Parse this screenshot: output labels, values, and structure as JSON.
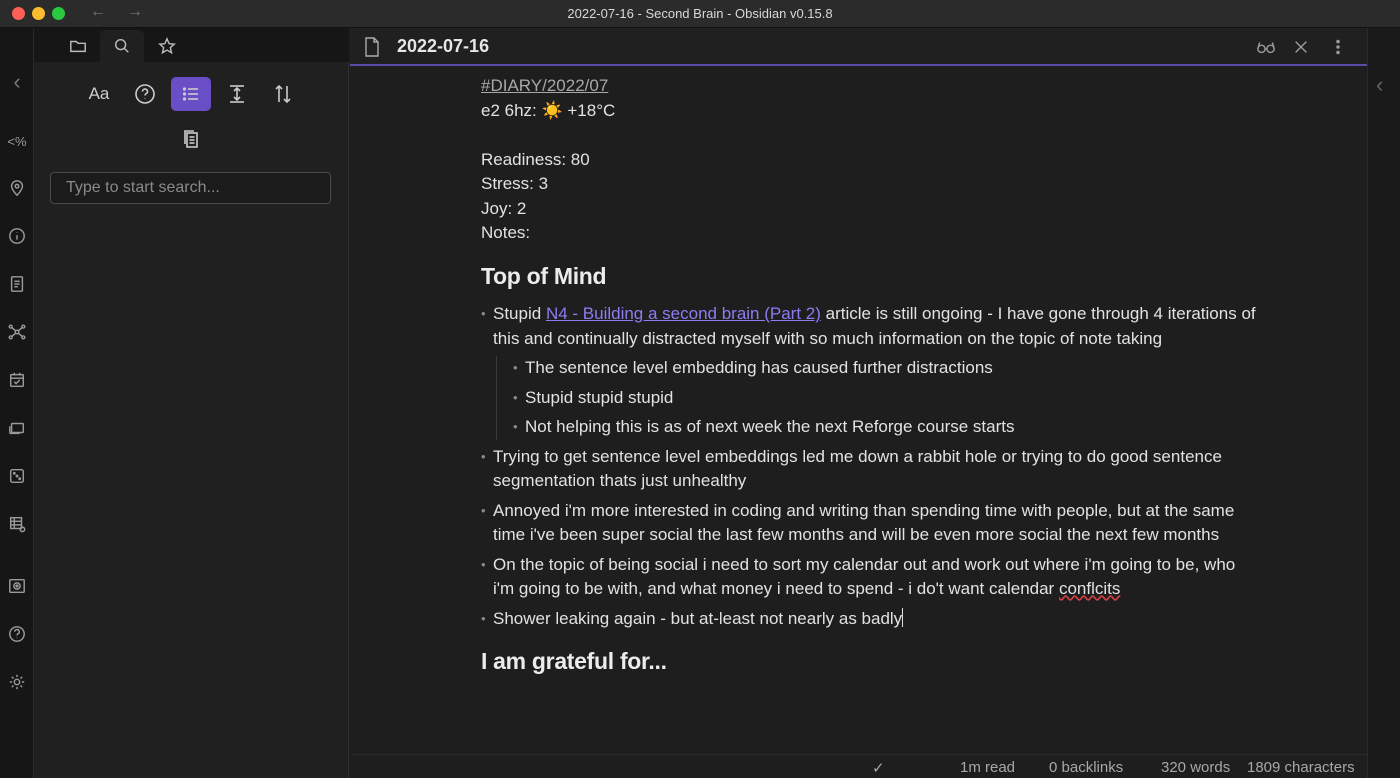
{
  "window": {
    "title": "2022-07-16 - Second Brain - Obsidian v0.15.8",
    "back_arrow": "←",
    "forward_arrow": "→"
  },
  "ribbon": {
    "collapse": "‹",
    "templater": "<%"
  },
  "side_panel": {
    "tabs": [
      "files-icon",
      "search-icon",
      "star-icon"
    ],
    "tools": {
      "match_case": "Aa",
      "help": "?"
    },
    "search": {
      "placeholder": "Type to start search...",
      "value": ""
    }
  },
  "editor": {
    "title": "2022-07-16",
    "tag": "#DIARY/2022/07",
    "weather": "e2 6hz: ☀️   +18°C",
    "readiness": "Readiness: 80",
    "stress": "Stress: 3",
    "joy": "Joy: 2",
    "notes": "Notes:",
    "heading_top": "Top of Mind",
    "b1_prefix": "Stupid ",
    "b1_link": "N4 - Building a second brain (Part 2)",
    "b1_suffix": " article is still ongoing - I  have gone through 4 iterations of this and continually distracted myself with so much information on the topic of note taking",
    "sub1": "The sentence level embedding has caused further distractions",
    "sub2": "Stupid stupid stupid",
    "sub3": "Not helping this is as of next week the next Reforge course starts",
    "b2": "Trying to get sentence level embeddings led me down a rabbit hole or trying to do good sentence segmentation thats just unhealthy",
    "b3": "Annoyed i'm more interested in coding and writing than spending time with people, but at the same time i've been super social the last few months and will be even more social the next few months",
    "b4_text": "On the topic of being social i need to sort my calendar out and work out where i'm going to be, who i'm going to be with, and what money i need to spend - i do't want calendar ",
    "b4_misspelled": "conflcits",
    "b5": "Shower leaking again - but at-least not nearly as badly",
    "heading_grateful": "I am grateful for..."
  },
  "status": {
    "check": "✓",
    "read_time": "1m read",
    "backlinks": "0 backlinks",
    "words": "320 words",
    "characters": "1809 characters"
  },
  "colors": {
    "accent": "#6a4ec6",
    "link": "#8d7cf0",
    "background": "#1e1e1e"
  }
}
